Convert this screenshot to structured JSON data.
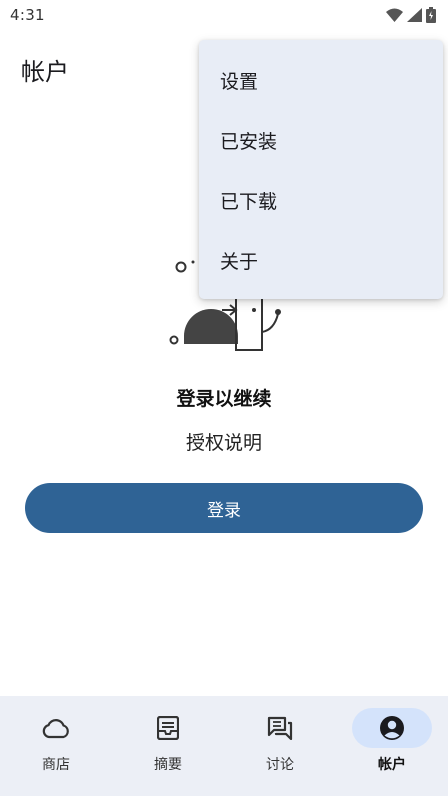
{
  "status_bar": {
    "time": "4:31"
  },
  "header": {
    "title": "帐户"
  },
  "menu": {
    "items": [
      {
        "label": "设置"
      },
      {
        "label": "已安装"
      },
      {
        "label": "已下载"
      },
      {
        "label": "关于"
      }
    ]
  },
  "login": {
    "heading": "登录以继续",
    "subtext": "授权说明",
    "button_label": "登录"
  },
  "bottom_nav": {
    "items": [
      {
        "label": "商店",
        "icon": "cloud-icon",
        "active": false
      },
      {
        "label": "摘要",
        "icon": "feed-icon",
        "active": false
      },
      {
        "label": "讨论",
        "icon": "forum-icon",
        "active": false
      },
      {
        "label": "帐户",
        "icon": "account-icon",
        "active": true
      }
    ]
  },
  "colors": {
    "accent": "#2f6395",
    "menu_background": "#e8edf6",
    "nav_background": "#eceff6",
    "active_indicator": "#d4e3fb"
  }
}
